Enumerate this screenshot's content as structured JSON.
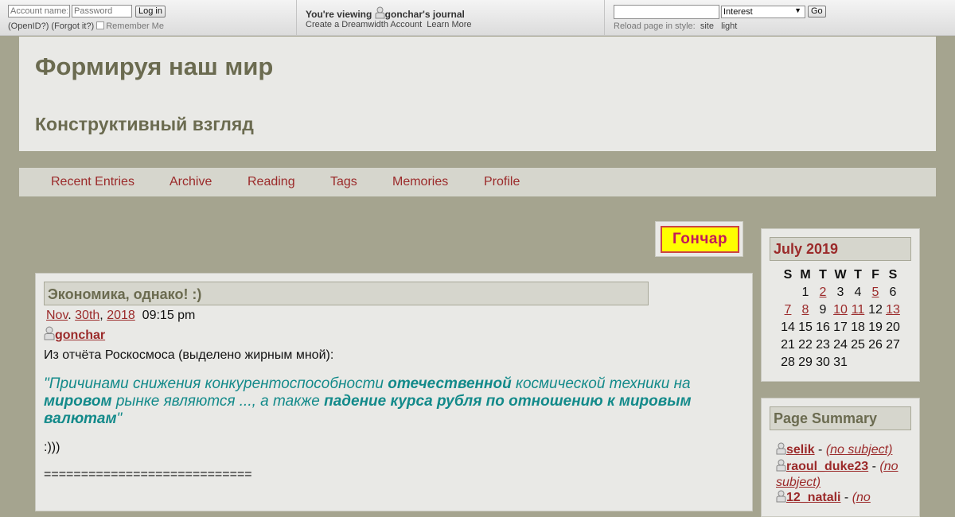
{
  "topbar": {
    "account_placeholder": "Account name:",
    "password_placeholder": "Password",
    "login_label": "Log in",
    "openid_link": "(OpenID?)",
    "forgot_link": "(Forgot it?)",
    "remember_label": "Remember Me",
    "viewing_prefix": "You're viewing",
    "journal_name": "gonchar's journal",
    "create_account_link": "Create a Dreamwidth Account",
    "learn_more_link": "Learn More",
    "search_value": "",
    "search_type": "Interest",
    "go_label": "Go",
    "reload_label": "Reload page in style:",
    "style_site": "site",
    "style_light": "light"
  },
  "header": {
    "title": "Формируя наш мир",
    "subtitle": "Конструктивный взгляд"
  },
  "nav": {
    "items": [
      "Recent Entries",
      "Archive",
      "Reading",
      "Tags",
      "Memories",
      "Profile"
    ]
  },
  "userpic": {
    "text": "Гончар"
  },
  "entry": {
    "subject": "Экономика, однако! :)",
    "date_month": "Nov",
    "date_day": "30th",
    "date_year": "2018",
    "time": "09:15 pm",
    "author": "gonchar",
    "intro": "Из отчёта Роскосмоса (выделено жирным мной):",
    "quote_parts": [
      "\"Причинами снижения конкурентоспособности ",
      "отечественной",
      " космической техники на ",
      "мировом",
      " рынке являются ..., а также ",
      "падение курса рубля по отношению к мировым валютам",
      "\""
    ],
    "smile": ":)))",
    "separator": "============================"
  },
  "calendar": {
    "title": "July 2019",
    "weekdays": [
      "S",
      "M",
      "T",
      "W",
      "T",
      "F",
      "S"
    ],
    "weeks": [
      [
        "",
        "1",
        "2",
        "3",
        "4",
        "5",
        "6"
      ],
      [
        "7",
        "8",
        "9",
        "10",
        "11",
        "12",
        "13"
      ],
      [
        "14",
        "15",
        "16",
        "17",
        "18",
        "19",
        "20"
      ],
      [
        "21",
        "22",
        "23",
        "24",
        "25",
        "26",
        "27"
      ],
      [
        "28",
        "29",
        "30",
        "31",
        "",
        "",
        ""
      ]
    ],
    "linked_days": [
      "2",
      "5",
      "7",
      "8",
      "10",
      "11",
      "13"
    ]
  },
  "summary": {
    "title": "Page Summary",
    "items": [
      {
        "user": "selik",
        "subject": "(no subject)"
      },
      {
        "user": "raoul_duke23",
        "subject": "(no subject)"
      },
      {
        "user": "12_natali",
        "subject": "(no"
      }
    ]
  },
  "colors": {
    "page_bg": "#a5a48f",
    "panel_bg": "#e9e9e6",
    "title_color": "#6b6b50",
    "link_color": "#9b2a2a",
    "quote_color": "#138a8a",
    "userpic_bg": "#ffff00"
  }
}
